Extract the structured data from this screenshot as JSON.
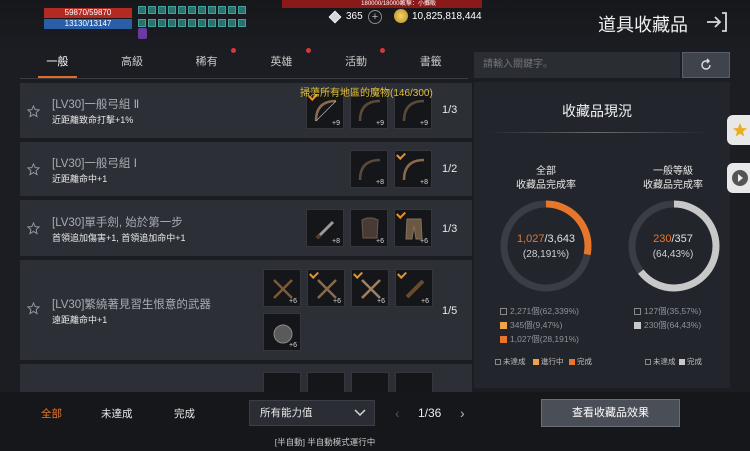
{
  "hud": {
    "hp": "59870/59870",
    "mp": "13130/13147",
    "top_bar": "180000/180000",
    "top_bar_right": "攻擊：小攤販",
    "gems": "365",
    "gold": "10,825,818,444"
  },
  "header": {
    "title": "道具收藏品"
  },
  "tabs": [
    {
      "label": "一般"
    },
    {
      "label": "高級"
    },
    {
      "label": "稀有"
    },
    {
      "label": "英雄"
    },
    {
      "label": "活動"
    },
    {
      "label": "書籤"
    }
  ],
  "search": {
    "placeholder": "請輸入關鍵字。"
  },
  "quest_hint": "掃蕩所有地區的魔物(146/300)",
  "collections": [
    {
      "title": "[LV30]一般弓組 Ⅱ",
      "effect": "近距離致命打擊+1%",
      "progress": "1/3",
      "slot_levels": [
        "+9",
        "+9",
        "+9"
      ]
    },
    {
      "title": "[LV30]一般弓組 Ⅰ",
      "effect": "近距離命中+1",
      "progress": "1/2",
      "slot_levels": [
        "+8",
        "+8"
      ]
    },
    {
      "title": "[LV30]單手劍, 始於第一步",
      "effect": "首領追加傷害+1, 首領追加命中+1",
      "progress": "1/3",
      "slot_levels": [
        "+8",
        "+6",
        "+6"
      ]
    },
    {
      "title": "[LV30]繁繞著見習生恨意的武器",
      "effect": "遠距離命中+1",
      "progress": "1/5",
      "slot_levels": [
        "+6",
        "+6",
        "+6",
        "+6",
        "+6"
      ]
    }
  ],
  "panel": {
    "title": "收藏品現況",
    "all": {
      "label_line1": "全部",
      "label_line2": "收藏品完成率",
      "done": "1,027",
      "total": "/3,643",
      "percent": "(28,191%)",
      "stats": [
        "2,271個(62,339%)",
        "345個(9,47%)",
        "1,027個(28,191%)"
      ]
    },
    "normal": {
      "label_line1": "一般等級",
      "label_line2": "收藏品完成率",
      "done": "230",
      "total": "/357",
      "percent": "(64,43%)",
      "stats": [
        "127個(35,57%)",
        "230個(64,43%)"
      ]
    },
    "legend": {
      "incomplete": "未達成",
      "in_progress": "進行中",
      "complete": "完成"
    },
    "colors": {
      "accent": "#e8762a",
      "in_progress": "#f0a24a",
      "gray": "#c8c8c8"
    }
  },
  "footer": {
    "filters": [
      {
        "label": "全部"
      },
      {
        "label": "未達成"
      },
      {
        "label": "完成"
      }
    ],
    "dropdown": "所有能力值",
    "page": "1/36",
    "view_button": "查看收藏品效果",
    "auto_text": "[半自動] 半自動模式運行中"
  }
}
